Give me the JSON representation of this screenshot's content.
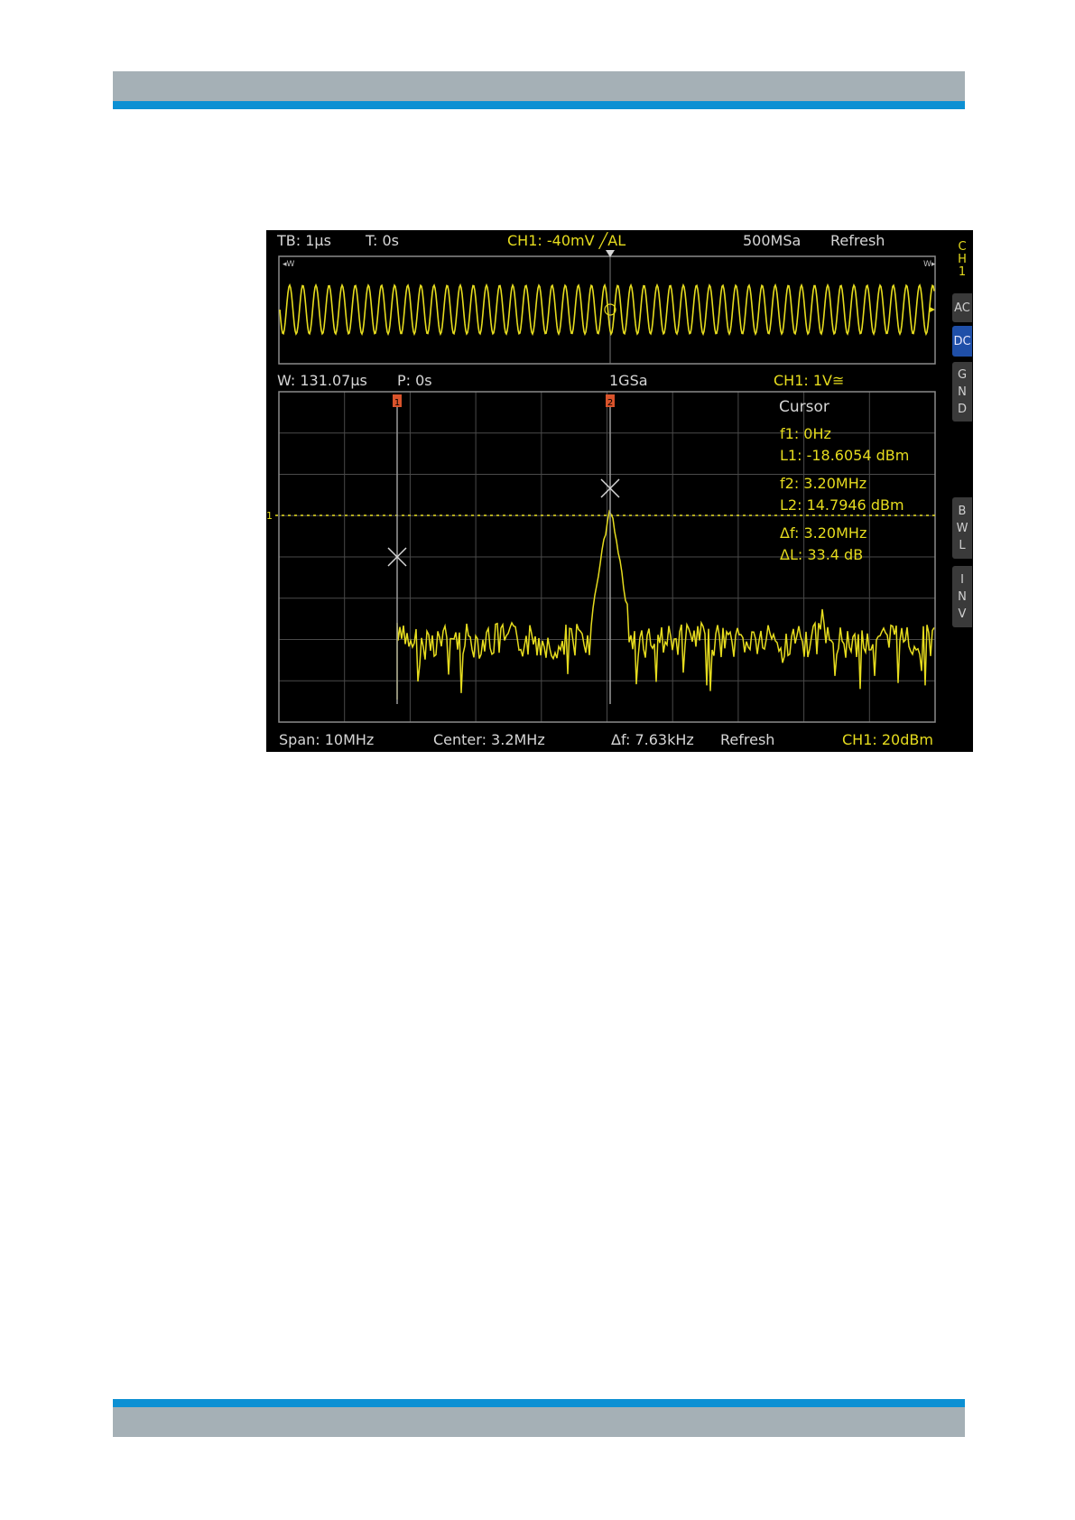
{
  "header_band": {
    "color": "#a5b0b6",
    "accent": "#0d90d3"
  },
  "footer_band": {
    "color": "#a5b0b6",
    "accent": "#0d90d3"
  },
  "scope": {
    "top_bar": {
      "timebase": "TB: 1µs",
      "trigger_time": "T: 0s",
      "trigger_info": "CH1: -40mV ╱AL",
      "sample_rate": "500MSa",
      "mode": "Refresh"
    },
    "zoom_bar": {
      "window": "W: 131.07µs",
      "position": "P: 0s",
      "sample_rate": "1GSa",
      "channel_scale": "CH1: 1V≅"
    },
    "bottom_bar": {
      "span": "Span: 10MHz",
      "center": "Center: 3.2MHz",
      "resolution": "Δf: 7.63kHz",
      "mode": "Refresh",
      "ref_level": "CH1: 20dBm"
    },
    "side_menu": {
      "channel": [
        "C",
        "H",
        "1"
      ],
      "buttons": [
        {
          "id": "ac",
          "label": "AC",
          "active": false
        },
        {
          "id": "dc",
          "label": "DC",
          "active": true
        },
        {
          "id": "gnd",
          "letters": [
            "G",
            "N",
            "D"
          ],
          "active": false
        },
        {
          "id": "bwl",
          "letters": [
            "B",
            "W",
            "L"
          ],
          "active": false
        },
        {
          "id": "inv",
          "letters": [
            "I",
            "N",
            "V"
          ],
          "active": false
        }
      ]
    },
    "cursor_panel": {
      "title": "Cursor",
      "f1": "f1: 0Hz",
      "l1": "L1: -18.6054 dBm",
      "f2": "f2: 3.20MHz",
      "l2": "L2: 14.7946 dBm",
      "df": "Δf: 3.20MHz",
      "dl": "ΔL: 33.4 dB"
    },
    "cursor_markers": [
      "1",
      "2"
    ],
    "channel_marker": "1",
    "colors": {
      "trace": "#e6dc1e",
      "cursor_marker": "#d9532b",
      "active_button": "#1f4fa8"
    }
  }
}
